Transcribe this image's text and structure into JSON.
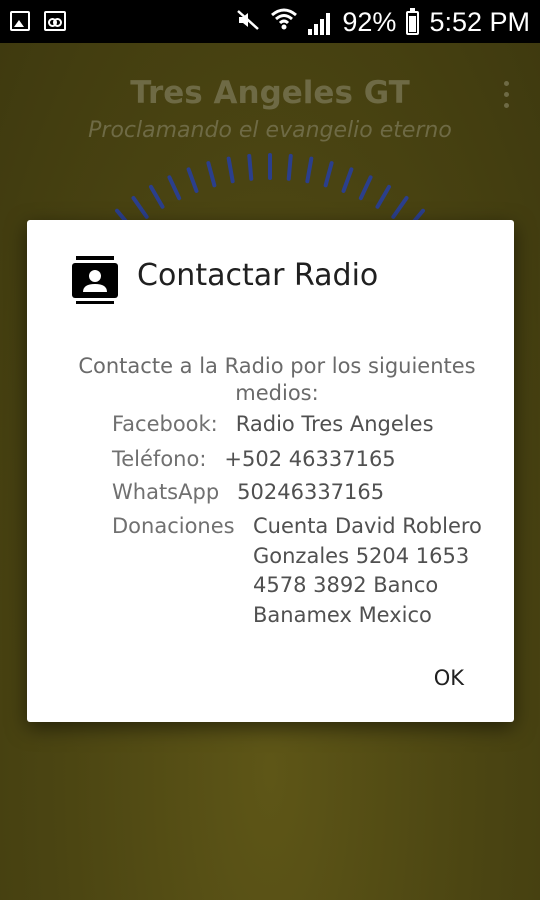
{
  "status_bar": {
    "left_icons": [
      "image-icon",
      "voicemail-icon"
    ],
    "right_icons": [
      "mute-icon",
      "wifi-icon",
      "signal-icon",
      "battery-icon"
    ],
    "battery": "92%",
    "time": "5:52 PM"
  },
  "app": {
    "title": "Tres Angeles GT",
    "subtitle": "Proclamando el evangelio eterno",
    "menu_icon": "more-vert-icon"
  },
  "dialog": {
    "icon": "contacts-icon",
    "title": "Contactar Radio",
    "intro": "Contacte a la Radio por los siguientes medios:",
    "rows": [
      {
        "label": "Facebook:",
        "value": "Radio Tres Angeles"
      },
      {
        "label": "Teléfono:",
        "value": "+502 46337165"
      },
      {
        "label": "WhatsApp",
        "value": "50246337165"
      },
      {
        "label": "Donaciones",
        "value_lines": [
          "Cuenta David Roblero",
          "Gonzales 5204 1653",
          "4578 3892 Banco",
          "Banamex Mexico"
        ]
      }
    ],
    "ok_label": "OK"
  },
  "colors": {
    "app_background": "#4b4512",
    "title_text": "#6e6a45",
    "visualizer": "#2b3f8c",
    "dialog_background": "#ffffff"
  }
}
